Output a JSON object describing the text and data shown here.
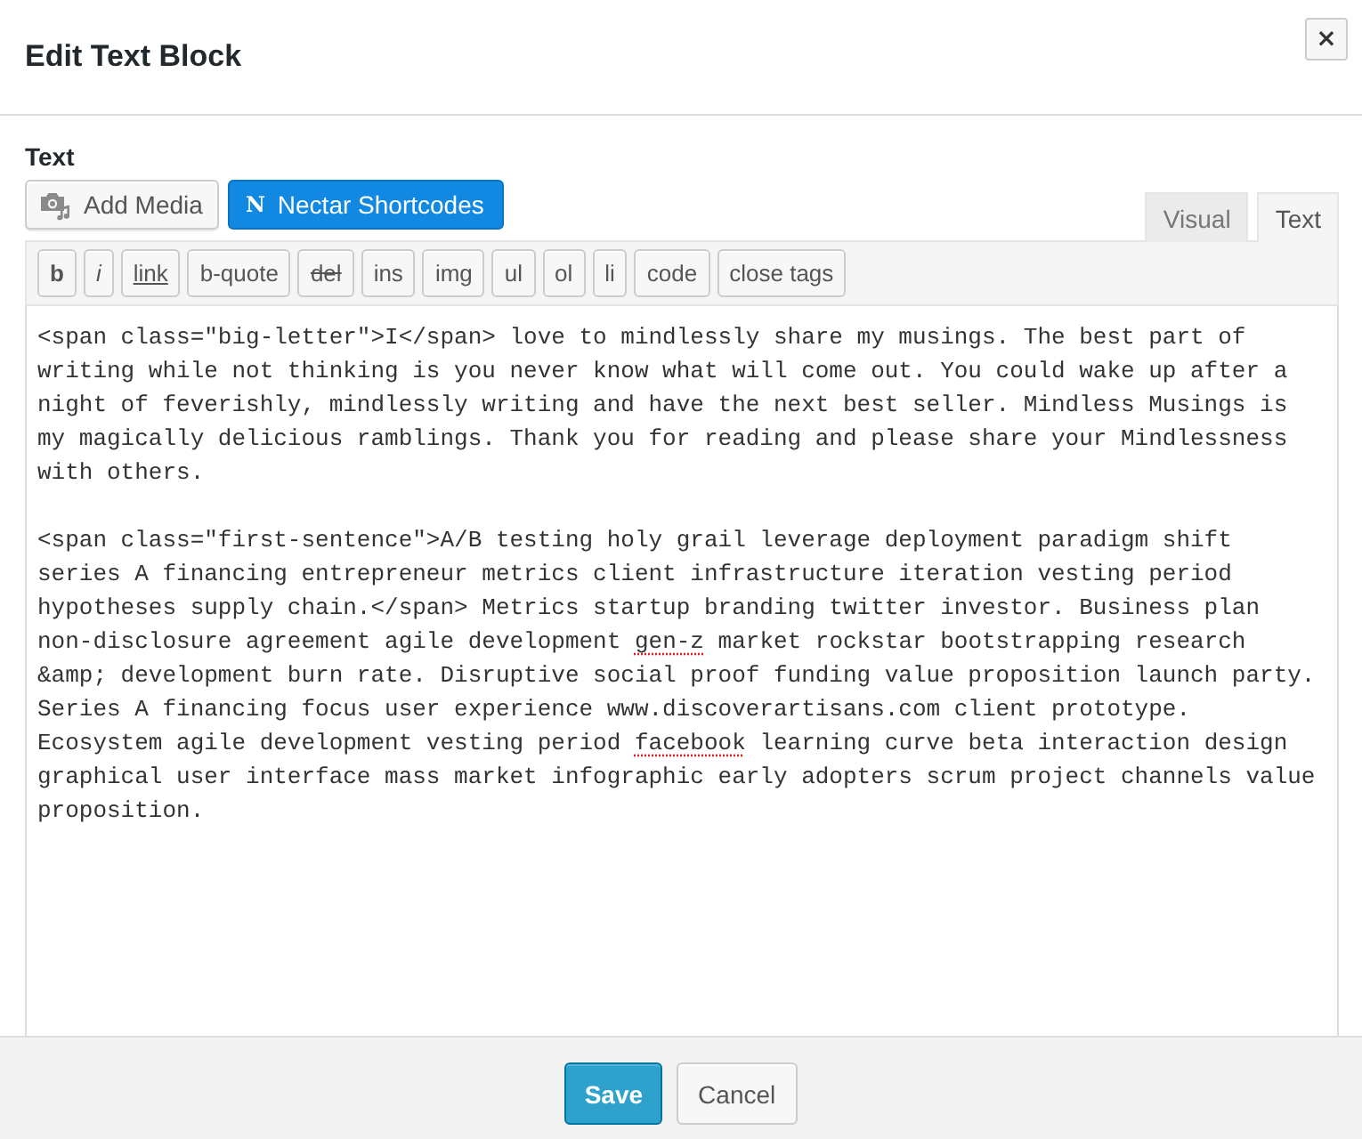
{
  "dialog": {
    "title": "Edit Text Block",
    "close_button": "×"
  },
  "field_label": "Text",
  "add_media_button": {
    "label": "Add Media"
  },
  "shortcodes_button": {
    "icon_letter": "N",
    "label": "Nectar Shortcodes"
  },
  "editor_tabs": [
    {
      "label": "Visual",
      "selected": false
    },
    {
      "label": "Text",
      "selected": true
    }
  ],
  "quicktags": [
    {
      "label": "b",
      "kind": "bold"
    },
    {
      "label": "i",
      "kind": "italic"
    },
    {
      "label": "link",
      "kind": "underline"
    },
    {
      "label": "b-quote",
      "kind": "plain"
    },
    {
      "label": "del",
      "kind": "strike"
    },
    {
      "label": "ins",
      "kind": "plain"
    },
    {
      "label": "img",
      "kind": "plain"
    },
    {
      "label": "ul",
      "kind": "plain"
    },
    {
      "label": "ol",
      "kind": "plain"
    },
    {
      "label": "li",
      "kind": "plain"
    },
    {
      "label": "code",
      "kind": "plain"
    },
    {
      "label": "close tags",
      "kind": "plain"
    }
  ],
  "content": [
    [
      {
        "text": "<span class=\"big-letter\">I</span> love to mindlessly share my musings. The best part of writing while not thinking is you never know what will come out. You could wake up after a night of feverishly, mindlessly writing and have the next best seller. Mindless Musings is my magically delicious ramblings. Thank you for reading and please share your Mindlessness with others.",
        "misspelled": false
      }
    ],
    [
      {
        "text": "<span class=\"first-sentence\">A/B testing holy grail leverage deployment paradigm shift series A financing entrepreneur metrics client infrastructure iteration vesting period hypotheses supply chain.</span> Metrics startup branding twitter investor. Business plan non-disclosure agreement agile development ",
        "misspelled": false
      },
      {
        "text": "gen-z",
        "misspelled": true
      },
      {
        "text": " market rockstar bootstrapping research &amp; development burn rate. Disruptive social proof funding value proposition launch party. Series A financing focus user experience www.discoverartisans.com client prototype. Ecosystem agile development vesting period ",
        "misspelled": false
      },
      {
        "text": "facebook",
        "misspelled": true
      },
      {
        "text": " learning curve beta interaction design graphical user interface mass market infographic early adopters scrum project channels value proposition.",
        "misspelled": false
      }
    ]
  ],
  "footer_buttons": [
    {
      "label": "Save",
      "kind": "primary"
    },
    {
      "label": "Cancel",
      "kind": "secondary"
    }
  ]
}
